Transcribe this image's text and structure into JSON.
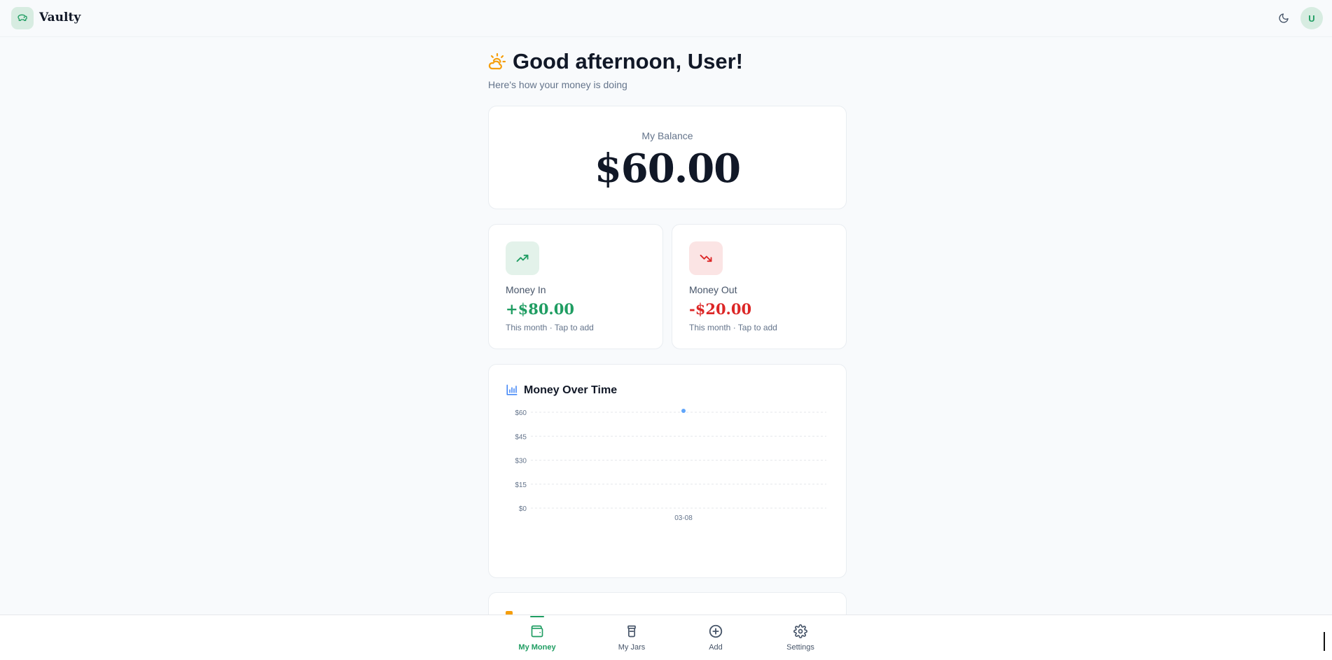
{
  "app": {
    "name": "Vaulty",
    "avatar_initial": "U",
    "brand_color": "#1f9d62",
    "icons": {
      "logo": "piggy-bank-icon",
      "theme_toggle": "moon-icon"
    }
  },
  "greeting": {
    "title": "Good afternoon, User!",
    "subtitle": "Here's how your money is doing",
    "icon": "sun-cloud-icon"
  },
  "balance": {
    "label": "My Balance",
    "amount": "$60.00"
  },
  "money_in": {
    "label": "Money In",
    "amount": "+$80.00",
    "note": "This month · Tap to add",
    "color": "#1f9d62",
    "icon": "trending-up-icon"
  },
  "money_out": {
    "label": "Money Out",
    "amount": "-$20.00",
    "note": "This month · Tap to add",
    "color": "#dc2626",
    "icon": "trending-down-icon"
  },
  "chart_section": {
    "title": "Money Over Time",
    "icon": "bar-chart-icon"
  },
  "chart_data": {
    "type": "line",
    "title": "Money Over Time",
    "xlabel": "",
    "ylabel": "",
    "x": [
      "03-08"
    ],
    "series": [
      {
        "values": [
          60
        ]
      }
    ],
    "yticks": [
      "$0",
      "$15",
      "$30",
      "$45",
      "$60"
    ],
    "ytick_values": [
      0,
      15,
      30,
      45,
      60
    ],
    "ylim": [
      0,
      60
    ],
    "grid": true,
    "line_color": "#60a5fa"
  },
  "nav": {
    "items": [
      {
        "label": "My Money",
        "icon": "wallet-icon",
        "active": true
      },
      {
        "label": "My Jars",
        "icon": "jar-icon",
        "active": false
      },
      {
        "label": "Add",
        "icon": "plus-circle-icon",
        "active": false
      },
      {
        "label": "Settings",
        "icon": "gear-icon",
        "active": false
      }
    ]
  }
}
